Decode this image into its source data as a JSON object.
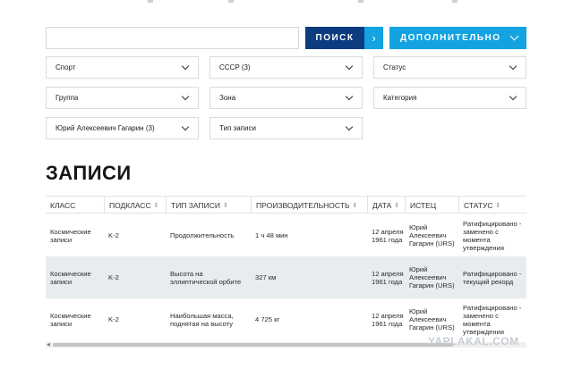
{
  "search": {
    "placeholder": "",
    "button_label": "ПОИСК",
    "more_label": "ДОПОЛНИТЕЛЬНО"
  },
  "filters": [
    {
      "label": "Спорт"
    },
    {
      "label": "СССР (3)"
    },
    {
      "label": "Статус"
    },
    {
      "label": "Группа"
    },
    {
      "label": "Зона"
    },
    {
      "label": "Категория"
    },
    {
      "label": "Юрий Алексеевич Гагарин (3)"
    },
    {
      "label": "Тип записи"
    }
  ],
  "section_title": "ЗАПИСИ",
  "table": {
    "headers": [
      "КЛАСС",
      "ПОДКЛАСС",
      "ТИП ЗАПИСИ",
      "ПРОИЗВОДИТЕЛЬНОСТЬ",
      "ДАТА",
      "ИСТЕЦ",
      "СТАТУС"
    ],
    "sort_icon": "⇕",
    "rows": [
      {
        "class": "Космические записи",
        "subclass": "K-2",
        "type": "Продолжительность",
        "performance": "1 ч 48 мин",
        "date": "12 апреля 1961 года",
        "claimant": "Юрий Алексеевич Гагарин (URS)",
        "status": "Ратифицировано - заменено с момента утверждения"
      },
      {
        "class": "Космические записи",
        "subclass": "K-2",
        "type": "Высота на эллиптической орбите",
        "performance": "327 км",
        "date": "12 апреля 1961 года",
        "claimant": "Юрий Алексеевич Гагарин (URS)",
        "status": "Ратифицировано - текущий рекорд"
      },
      {
        "class": "Космические записи",
        "subclass": "K-2",
        "type": "Наибольшая масса, поднятая на высоту",
        "performance": "4 725 кг",
        "date": "12 апреля 1961 года",
        "claimant": "Юрий Алексеевич Гагарин (URS)",
        "status": "Ратифицировано - заменено с момента утверждения"
      }
    ]
  },
  "watermark": "YAPLAKAL.COM",
  "colors": {
    "primary": "#0c3b80",
    "accent": "#13a3e0",
    "row_alt": "#e6ecf0"
  },
  "icons": {
    "search_arrow": "chevron-right-icon",
    "dropdown": "chevron-down-icon",
    "scroll_left": "triangle-left-icon"
  }
}
